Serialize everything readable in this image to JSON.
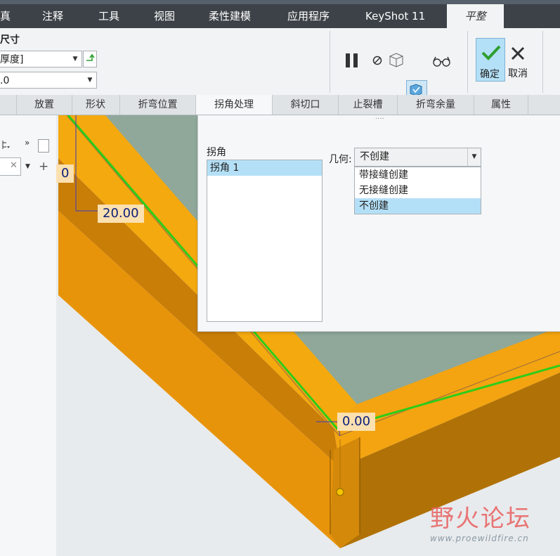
{
  "ribbon": {
    "tabs": [
      {
        "label": "真"
      },
      {
        "label": "注释"
      },
      {
        "label": "工具"
      },
      {
        "label": "视图"
      },
      {
        "label": "柔性建模"
      },
      {
        "label": "应用程序"
      },
      {
        "label": "KeyShot 11"
      },
      {
        "label": "平整"
      }
    ],
    "group_title": "尺寸",
    "thickness_combo_value": "厚度]",
    "value_combo_value": ".0",
    "ok_label": "确定",
    "cancel_label": "取消"
  },
  "subtabs": [
    {
      "label": "放置"
    },
    {
      "label": "形状"
    },
    {
      "label": "折弯位置"
    },
    {
      "label": "拐角处理"
    },
    {
      "label": "斜切口"
    },
    {
      "label": "止裂槽"
    },
    {
      "label": "折弯余量"
    },
    {
      "label": "属性"
    }
  ],
  "panel": {
    "handle": "····",
    "corner_label": "拐角",
    "corners": [
      "拐角 1"
    ],
    "geometry_label": "几何:",
    "geometry_value": "不创建",
    "geometry_options": [
      "带接缝创建",
      "无接缝创建",
      "不创建"
    ],
    "geometry_selected_index": 2
  },
  "dimensions": {
    "dim_left": "0",
    "dim_main": "20.00",
    "dim_corner": "0.00"
  },
  "watermark": {
    "title": "野火论坛",
    "url": "www.proewildfire.cn"
  },
  "colors": {
    "ribbon_dark": "#3c4248",
    "model_orange": "#f0a010",
    "model_edge_green": "#2ecc1a",
    "plate_gray": "#8fa89a",
    "selection_blue": "#b4e0f7",
    "ok_green": "#2e9e2e"
  }
}
